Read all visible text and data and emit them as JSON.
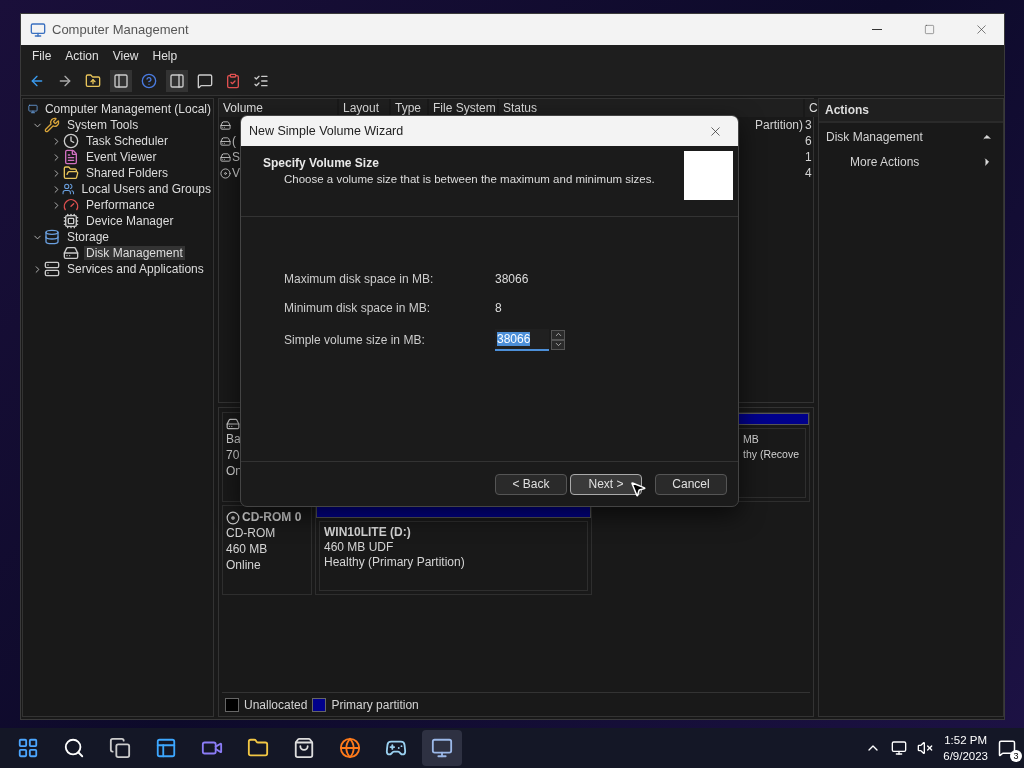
{
  "window": {
    "title": "Computer Management"
  },
  "menu": [
    "File",
    "Action",
    "View",
    "Help"
  ],
  "toolbar": [
    {
      "kind": "back"
    },
    {
      "kind": "forward"
    },
    {
      "kind": "up"
    },
    {
      "kind": "tree"
    },
    {
      "kind": "help"
    },
    {
      "kind": "pane"
    },
    {
      "kind": "chat"
    },
    {
      "kind": "check"
    },
    {
      "kind": "list"
    }
  ],
  "tree": [
    {
      "label": "Computer Management (Local)",
      "kind": "computer",
      "selected": false,
      "children": [
        {
          "label": "System Tools",
          "kind": "tools",
          "expanded": true,
          "selected": false,
          "children": [
            {
              "label": "Task Scheduler",
              "kind": "clock",
              "expanded": false,
              "selected": false
            },
            {
              "label": "Event Viewer",
              "kind": "log",
              "expanded": false,
              "selected": false
            },
            {
              "label": "Shared Folders",
              "kind": "folder",
              "expanded": false,
              "selected": false
            },
            {
              "label": "Local Users and Groups",
              "kind": "users",
              "expanded": false,
              "selected": false
            },
            {
              "label": "Performance",
              "kind": "gauge",
              "expanded": false,
              "selected": false
            },
            {
              "label": "Device Manager",
              "kind": "device",
              "selected": false
            }
          ]
        },
        {
          "label": "Storage",
          "kind": "storage",
          "expanded": true,
          "selected": false,
          "children": [
            {
              "label": "Disk Management",
              "kind": "disk",
              "selected": true
            }
          ]
        },
        {
          "label": "Services and Applications",
          "kind": "services",
          "expanded": false,
          "selected": false
        }
      ]
    }
  ],
  "volume_list": {
    "columns": [
      "Volume",
      "Layout",
      "Type",
      "File System",
      "Status",
      "C"
    ],
    "rows": [
      {
        "kind": "disk",
        "status": "Partition)",
        "capacity": "3"
      },
      {
        "kind": "disk",
        "volume": "(",
        "capacity": "6"
      },
      {
        "kind": "disk",
        "volume": "S",
        "capacity": "1"
      },
      {
        "kind": "cd",
        "volume": "V",
        "capacity": "4"
      }
    ]
  },
  "disks": [
    {
      "kind": "basic",
      "lines": [
        "Ba",
        "70",
        "On"
      ],
      "partitions": [
        {
          "lines": [
            "MB",
            "thy (Recove"
          ]
        }
      ]
    },
    {
      "kind": "cdrom",
      "name": "CD-ROM 0",
      "lines": [
        "CD-ROM",
        "460 MB",
        "Online"
      ],
      "partitions": [
        {
          "title": "WIN10LITE  (D:)",
          "lines": [
            "460 MB UDF",
            "Healthy (Primary Partition)"
          ]
        }
      ]
    }
  ],
  "legend": [
    {
      "label": "Unallocated",
      "color": "#000000"
    },
    {
      "label": "Primary partition",
      "color": "#00008b"
    }
  ],
  "actions": {
    "title": "Actions",
    "sections": [
      {
        "title": "Disk Management",
        "expanded": true,
        "items": [
          "More Actions"
        ]
      }
    ]
  },
  "dialog": {
    "title": "New Simple Volume Wizard",
    "heading": "Specify Volume Size",
    "subtitle": "Choose a volume size that is between the maximum and minimum sizes.",
    "fields": [
      {
        "kind": "readout",
        "label": "Maximum disk space in MB:",
        "value": "38066"
      },
      {
        "kind": "readout",
        "label": "Minimum disk space in MB:",
        "value": "8"
      },
      {
        "kind": "spin",
        "label": "Simple volume size in MB:",
        "value": "38066",
        "value_selected": true
      }
    ],
    "buttons": [
      {
        "label": "< Back",
        "focused": false
      },
      {
        "label": "Next >",
        "focused": true
      },
      {
        "label": "Cancel",
        "focused": false
      }
    ]
  },
  "taskbar": {
    "apps": [
      {
        "kind": "start",
        "active": false
      },
      {
        "kind": "search",
        "active": false
      },
      {
        "kind": "taskview",
        "active": false
      },
      {
        "kind": "widgets",
        "active": false
      },
      {
        "kind": "chat",
        "active": false
      },
      {
        "kind": "explorer",
        "active": false
      },
      {
        "kind": "store",
        "active": false
      },
      {
        "kind": "browser",
        "active": false
      },
      {
        "kind": "game",
        "active": false
      },
      {
        "kind": "management",
        "active": true
      }
    ],
    "time": "1:52 PM",
    "date": "6/9/2023",
    "notification_count": "3"
  }
}
